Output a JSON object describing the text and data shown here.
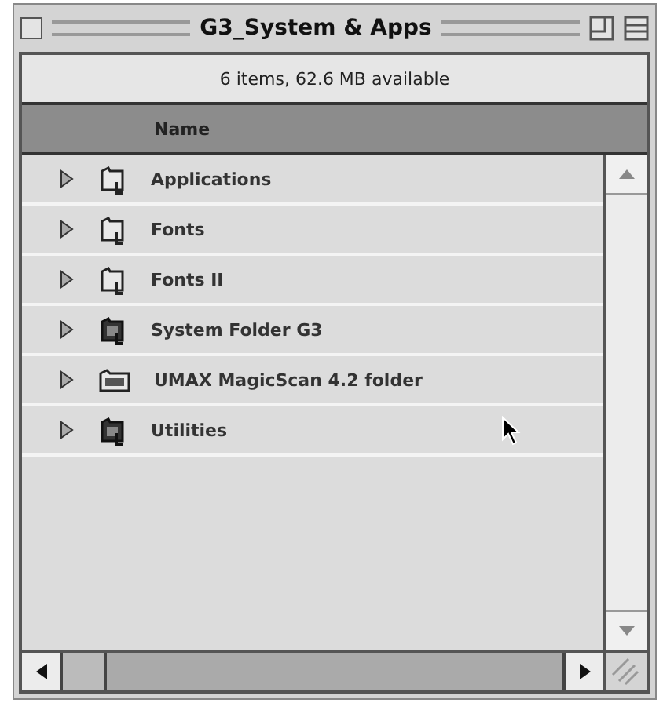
{
  "window": {
    "title": "G3_System & Apps"
  },
  "info_bar": "6 items, 62.6 MB available",
  "columns": [
    {
      "label": "Name",
      "selected": true
    }
  ],
  "items": [
    {
      "name": "Applications",
      "kind": "folder",
      "expanded": false
    },
    {
      "name": "Fonts",
      "kind": "folder",
      "expanded": false
    },
    {
      "name": "Fonts II",
      "kind": "folder",
      "expanded": false
    },
    {
      "name": "System Folder G3",
      "kind": "system",
      "expanded": false
    },
    {
      "name": "UMAX MagicScan 4.2 folder",
      "kind": "app",
      "expanded": false
    },
    {
      "name": "Utilities",
      "kind": "system",
      "expanded": false
    }
  ]
}
